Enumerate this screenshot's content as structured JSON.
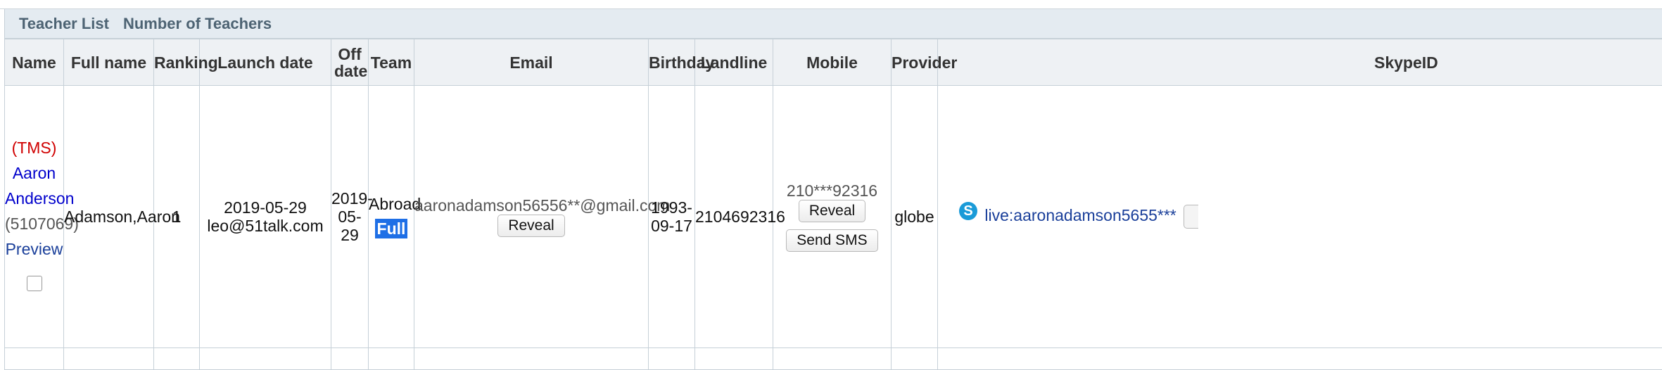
{
  "title_bar": {
    "teacher_list": "Teacher List",
    "number_of_teachers": "Number of Teachers"
  },
  "columns": [
    "Name",
    "Full name",
    "Ranking",
    "Launch date",
    "Off date",
    "Team",
    "Email",
    "Birthday",
    "Landline",
    "Mobile",
    "Provider",
    "SkypeID"
  ],
  "row": {
    "name_tag": "(TMS)",
    "name_first": "Aaron",
    "name_last": "Anderson",
    "teacher_id": "(5107069)",
    "preview_link": "Preview",
    "full_name": "Adamson,Aaron",
    "ranking": "1",
    "launch_date": "2019-05-29",
    "launch_by": "leo@51talk.com",
    "off_date_line1": "2019-",
    "off_date_line2": "05-29",
    "team": "Abroad",
    "team_status": "Full",
    "email": "aaronadamson56556**@gmail.com",
    "email_reveal": "Reveal",
    "birthday_line1": "1993-",
    "birthday_line2": "09-17",
    "landline": "2104692316",
    "mobile": "210***92316",
    "mobile_reveal": "Reveal",
    "send_sms": "Send SMS",
    "provider": "globe",
    "skype_id": "live:aaronadamson5655***"
  },
  "colors": {
    "header_bg": "#eef1f4",
    "title_bar_bg": "#e4ebf1",
    "tms_red": "#d00000",
    "name_blue": "#0000cc",
    "full_badge": "#1e6fe6",
    "skype_blue": "#1a9bd8"
  }
}
